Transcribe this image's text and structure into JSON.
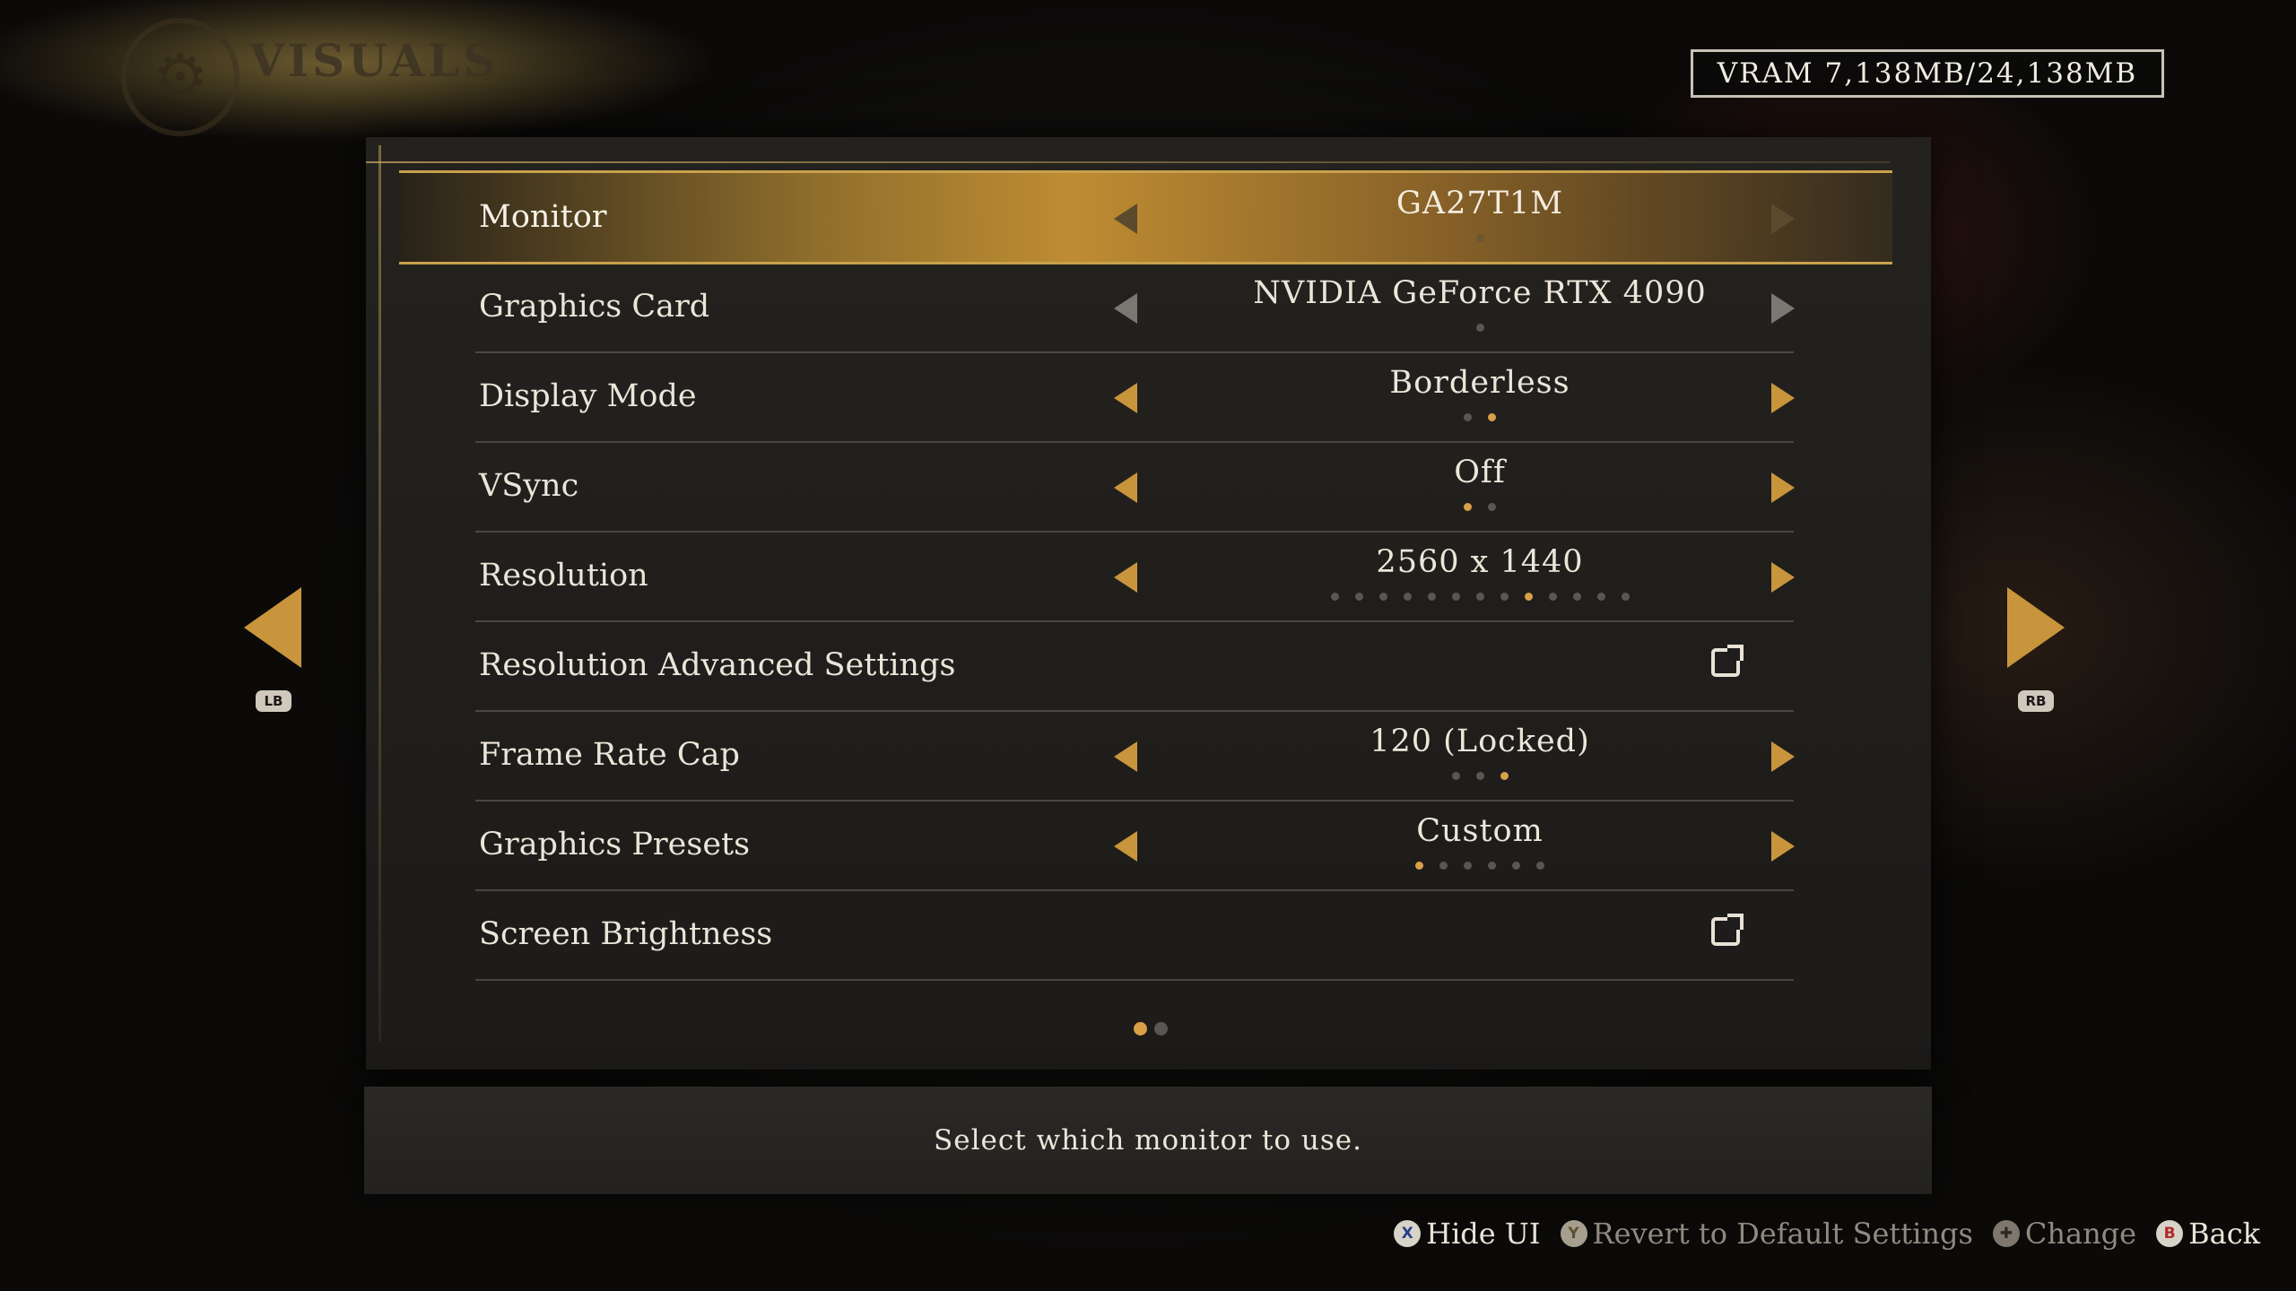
{
  "header": {
    "title": "VISUALS",
    "vram": "VRAM 7,138MB/24,138MB"
  },
  "rows": [
    {
      "label": "Monitor",
      "value": "GA27T1M",
      "dots": 1,
      "active": 0,
      "arrows": "dim"
    },
    {
      "label": "Graphics Card",
      "value": "NVIDIA GeForce RTX 4090",
      "dots": 1,
      "active": 0,
      "arrows": "dim"
    },
    {
      "label": "Display Mode",
      "value": "Borderless",
      "dots": 2,
      "active": 1,
      "arrows": "active"
    },
    {
      "label": "VSync",
      "value": "Off",
      "dots": 2,
      "active": 0,
      "arrows": "active"
    },
    {
      "label": "Resolution",
      "value": "2560 x 1440",
      "dots": 13,
      "active": 8,
      "arrows": "active"
    },
    {
      "label": "Resolution Advanced Settings",
      "type": "link"
    },
    {
      "label": "Frame Rate Cap",
      "value": "120 (Locked)",
      "dots": 3,
      "active": 2,
      "arrows": "active"
    },
    {
      "label": "Graphics Presets",
      "value": "Custom",
      "dots": 6,
      "active": 0,
      "arrows": "active"
    },
    {
      "label": "Screen Brightness",
      "type": "link"
    }
  ],
  "pagination": {
    "pages": 2,
    "current": 0
  },
  "description": "Select which monitor to use.",
  "nav": {
    "left_bumper": "LB",
    "right_bumper": "RB"
  },
  "footer": [
    {
      "button": "X",
      "label": "Hide UI",
      "enabled": true
    },
    {
      "button": "Y",
      "label": "Revert to Default Settings",
      "enabled": false
    },
    {
      "button": "dpad",
      "label": "Change",
      "enabled": false
    },
    {
      "button": "B",
      "label": "Back",
      "enabled": true
    }
  ],
  "colors": {
    "accent": "#c8953c",
    "selected_row": "#be8c32",
    "dot_active": "#d9a048"
  },
  "icons": {
    "header": "gear-icon",
    "link": "external-link-icon",
    "prev": "chevron-left-icon",
    "next": "chevron-right-icon"
  }
}
